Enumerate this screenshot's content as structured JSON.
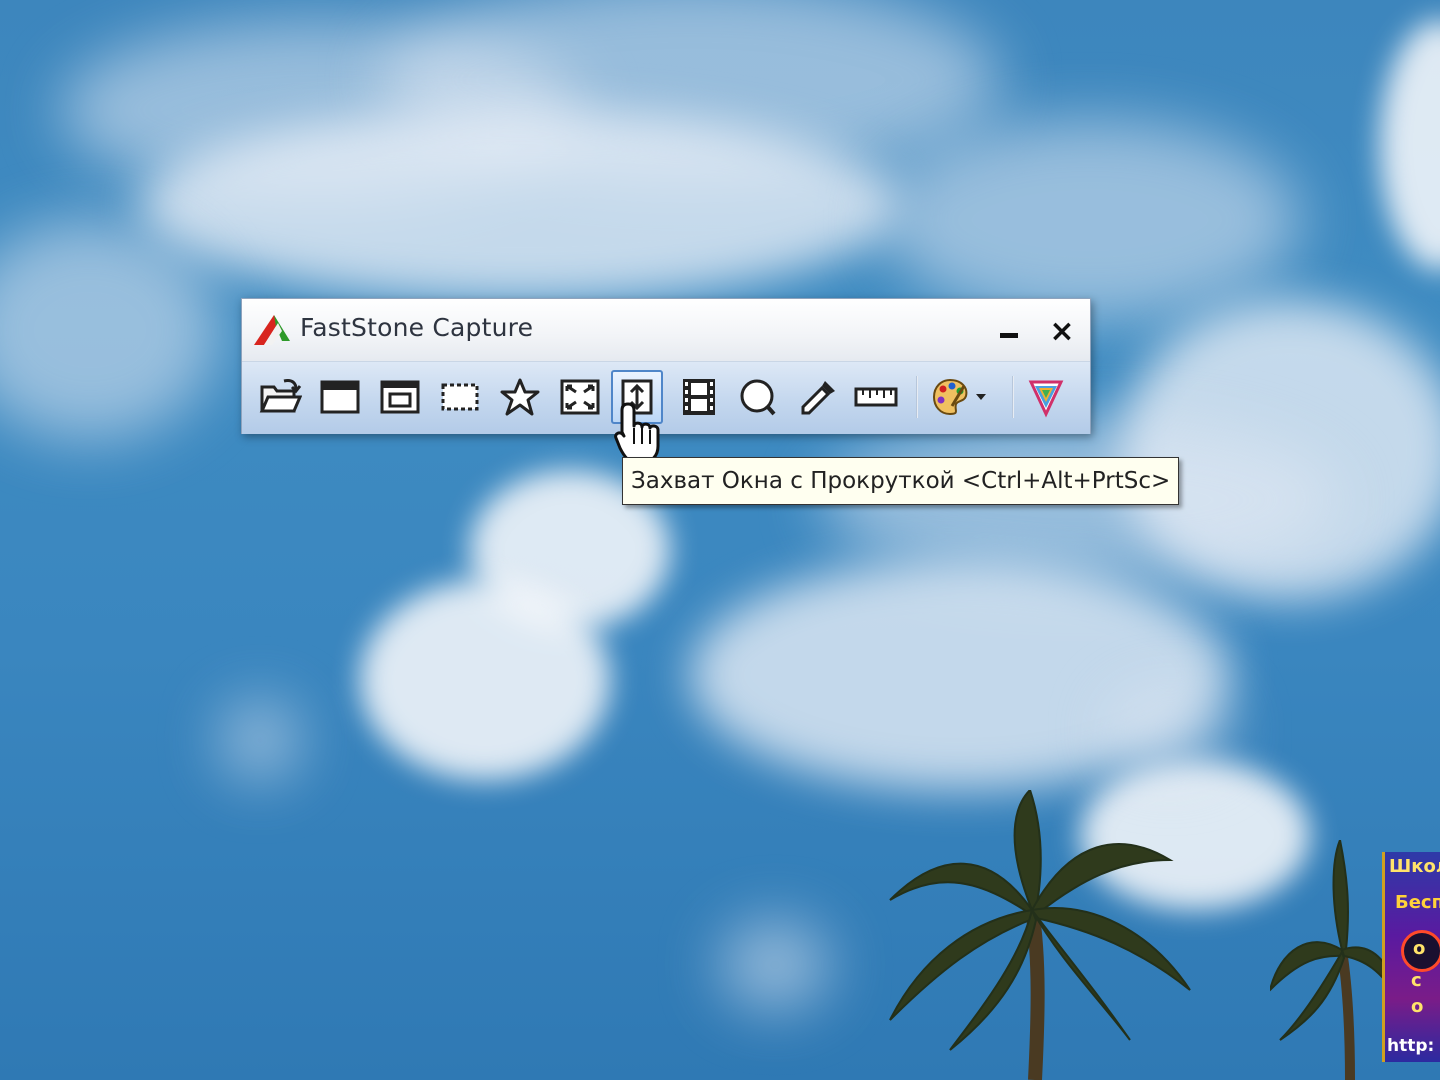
{
  "window": {
    "title": "FastStone Capture",
    "minimize_icon": "minimize-icon",
    "close_label": "×"
  },
  "toolbar": {
    "buttons": [
      {
        "name": "open-file-button",
        "icon": "folder-open-icon"
      },
      {
        "name": "capture-active-window-button",
        "icon": "window-icon"
      },
      {
        "name": "capture-window-object-button",
        "icon": "window-object-icon"
      },
      {
        "name": "capture-rectangular-region-button",
        "icon": "rectangle-region-icon"
      },
      {
        "name": "capture-freehand-region-button",
        "icon": "freehand-region-icon"
      },
      {
        "name": "capture-full-screen-button",
        "icon": "full-screen-icon"
      },
      {
        "name": "capture-scrolling-window-button",
        "icon": "scrolling-window-icon",
        "active": true
      },
      {
        "name": "screen-recorder-button",
        "icon": "film-icon"
      },
      {
        "name": "screen-magnifier-button",
        "icon": "magnifier-icon"
      },
      {
        "name": "color-picker-button",
        "icon": "eyedropper-icon"
      },
      {
        "name": "screen-ruler-button",
        "icon": "ruler-icon"
      },
      {
        "name": "output-settings-button",
        "icon": "palette-icon"
      },
      {
        "name": "settings-menu-button",
        "icon": "settings-triangle-icon"
      }
    ]
  },
  "tooltip": {
    "text": "Захват Окна с Прокруткой <Ctrl+Alt+PrtSc>"
  },
  "corner_ad": {
    "lines": [
      "Школ",
      "Бесп",
      "о",
      "с",
      "о",
      "http:"
    ]
  },
  "colors": {
    "sky": "#3d86bd",
    "toolbar": "#c4d7ee",
    "tooltip_bg": "#fffff0",
    "active_border": "#4f86c9"
  }
}
